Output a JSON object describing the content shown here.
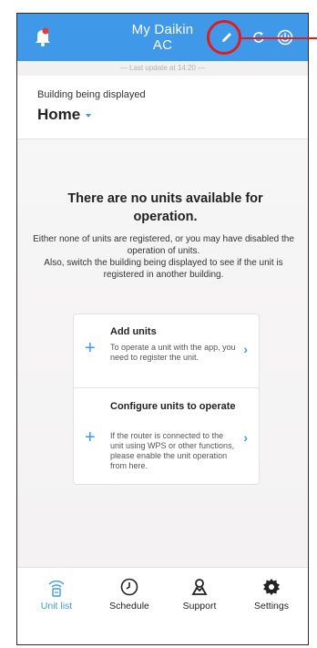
{
  "header": {
    "title_line1": "My Daikin",
    "title_line2": "AC",
    "last_update": "— Last update at 14:20 —"
  },
  "building": {
    "label": "Building being displayed",
    "selected": "Home"
  },
  "empty_state": {
    "title": "There are no units available for operation.",
    "description": "Either none of units are registered, or you may have disabled the operation of units.\nAlso, switch the building being displayed to see if the unit is registered in another building."
  },
  "actions": [
    {
      "title": "Add units",
      "description": "To operate a unit with the app, you need to register the unit."
    },
    {
      "title": "Configure units to operate",
      "description": "If the router is connected to the unit using WPS or other functions, please enable the unit operation from here."
    }
  ],
  "nav": [
    {
      "label": "Unit list",
      "icon": "unit-list-icon",
      "active": true
    },
    {
      "label": "Schedule",
      "icon": "clock-icon",
      "active": false
    },
    {
      "label": "Support",
      "icon": "support-icon",
      "active": false
    },
    {
      "label": "Settings",
      "icon": "gear-icon",
      "active": false
    }
  ],
  "colors": {
    "accent": "#3f98e8",
    "annotation": "#e11c1c"
  }
}
